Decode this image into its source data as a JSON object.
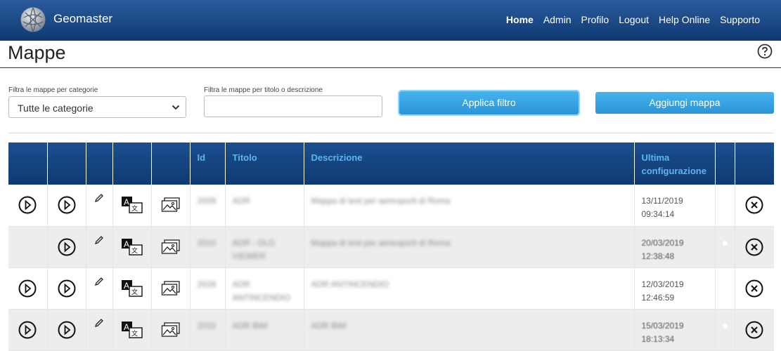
{
  "header": {
    "brand": "Geomaster",
    "nav": [
      "Home",
      "Admin",
      "Profilo",
      "Logout",
      "Help Online",
      "Supporto"
    ]
  },
  "page": {
    "title": "Mappe"
  },
  "filters": {
    "category_label": "Filtra le mappe per categorie",
    "category_value": "Tutte le categorie",
    "text_label": "Filtra le mappe per titolo o descrizione",
    "text_value": "",
    "apply_label": "Applica filtro",
    "add_label": "Aggiungi mappa"
  },
  "table": {
    "headers": {
      "id": "Id",
      "title": "Titolo",
      "description": "Descrizione",
      "last_config": "Ultima configurazione"
    },
    "rows": [
      {
        "id": "2009",
        "title": "ADR",
        "description": "Mappa di test per aereoporti di Roma",
        "date": "13/11/2019",
        "time": "09:34:14"
      },
      {
        "id": "2010",
        "title": "ADR - OLD VIEWER",
        "description": "Mappa di test per aereoporti di Roma",
        "date": "20/03/2019",
        "time": "12:38:48"
      },
      {
        "id": "2028",
        "title": "ADR ANTINCENDIO",
        "description": "ADR ANTINCENDIO",
        "date": "12/03/2019",
        "time": "12:46:59"
      },
      {
        "id": "2032",
        "title": "ADR BIM",
        "description": "ADR BIM",
        "date": "15/03/2019",
        "time": "18:13:34"
      }
    ]
  },
  "icons": {
    "play": "play-circle-icon",
    "edit": "pencil-icon",
    "translate": "translate-icon",
    "image": "image-icon",
    "delete": "close-circle-icon",
    "help": "help-circle-icon"
  }
}
